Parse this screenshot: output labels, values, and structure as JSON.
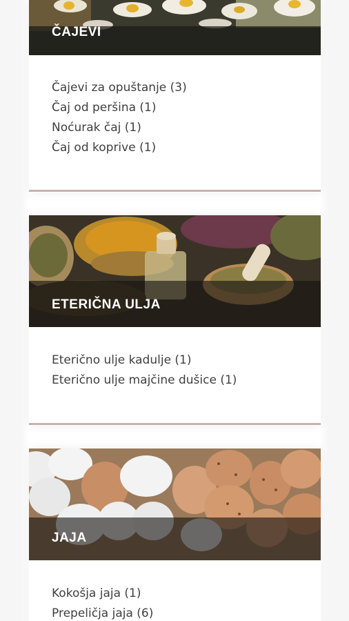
{
  "sections": [
    {
      "title": "ČAJEVI",
      "items": [
        "Čajevi za opuštanje (3)",
        "Čaj od peršina (1)",
        "Noćurak čaj (1)",
        "Čaj od koprive (1)"
      ]
    },
    {
      "title": "ETERIČNA ULJA",
      "items": [
        "Eterično ulje kadulje (1)",
        "Eterično ulje majčine dušice (1)"
      ]
    },
    {
      "title": "JAJA",
      "items": [
        "Kokošja jaja (1)",
        "Prepeličja jaja (6)"
      ]
    }
  ],
  "colors": {
    "divider": "#c9b0ae",
    "banner_text": "#ffffff",
    "link_text": "#3f3f3f"
  }
}
